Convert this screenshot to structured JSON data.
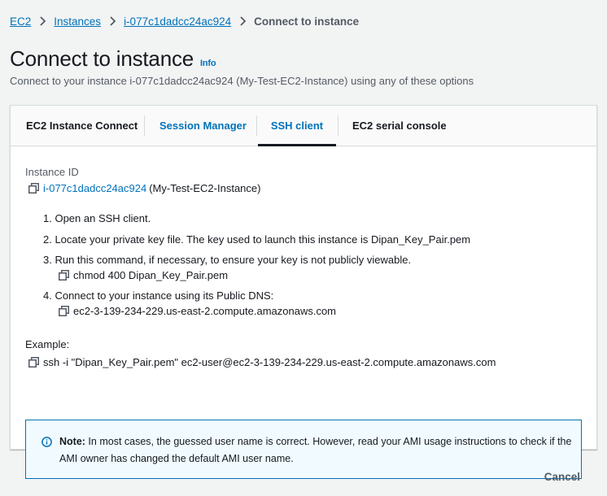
{
  "breadcrumb": {
    "items": [
      "EC2",
      "Instances",
      "i-077c1dadcc24ac924"
    ],
    "current": "Connect to instance"
  },
  "header": {
    "title": "Connect to instance",
    "info_label": "Info",
    "description": "Connect to your instance i-077c1dadcc24ac924 (My-Test-EC2-Instance) using any of these options"
  },
  "tabs": [
    {
      "label": "EC2 Instance Connect",
      "active": false
    },
    {
      "label": "Session Manager",
      "active": false
    },
    {
      "label": "SSH client",
      "active": true
    },
    {
      "label": "EC2 serial console",
      "active": false
    }
  ],
  "ssh": {
    "instance_id_label": "Instance ID",
    "instance_id": "i-077c1dadcc24ac924",
    "instance_name": "(My-Test-EC2-Instance)",
    "steps": [
      "1. Open an SSH client.",
      "2. Locate your private key file. The key used to launch this instance is Dipan_Key_Pair.pem",
      "3. Run this command, if necessary, to ensure your key is not publicly viewable.",
      "4. Connect to your instance using its Public DNS:"
    ],
    "chmod_command": "chmod 400 Dipan_Key_Pair.pem",
    "public_dns": "ec2-3-139-234-229.us-east-2.compute.amazonaws.com",
    "example_label": "Example:",
    "example_command": "ssh -i \"Dipan_Key_Pair.pem\" ec2-user@ec2-3-139-234-229.us-east-2.compute.amazonaws.com"
  },
  "note": {
    "label": "Note:",
    "text": " In most cases, the guessed user name is correct. However, read your AMI usage instructions to check if the AMI owner has changed the default AMI user name."
  },
  "footer": {
    "cancel_label": "Cancel"
  },
  "icons": {
    "breadcrumb_separator": "chevron-right-icon",
    "copy": "copy-icon",
    "info": "info-circle-icon"
  },
  "colors": {
    "link": "#0073bb",
    "text": "#16191f",
    "muted": "#545b64",
    "note_bg": "#f1faff",
    "note_border": "#0073bb",
    "page_bg": "#f2f3f3"
  }
}
